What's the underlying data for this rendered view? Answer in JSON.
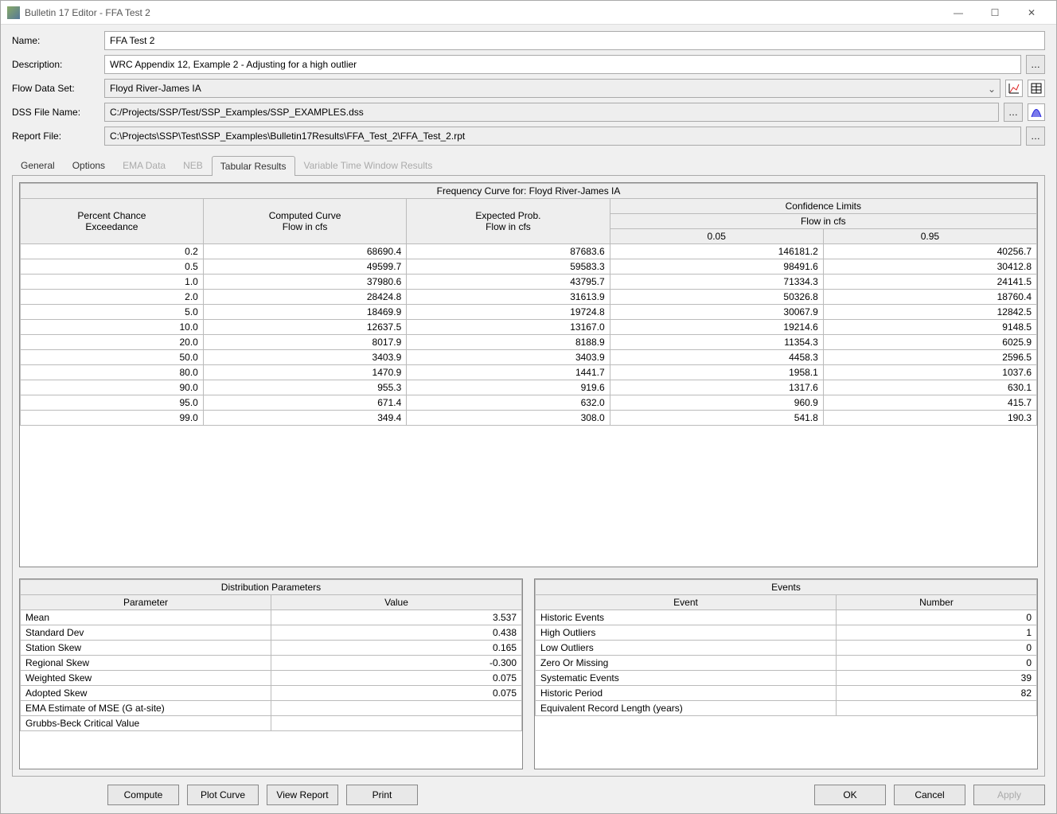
{
  "window_title": "Bulletin 17 Editor - FFA Test 2",
  "labels": {
    "name": "Name:",
    "description": "Description:",
    "flow_data_set": "Flow Data Set:",
    "dss_file_name": "DSS File Name:",
    "report_file": "Report File:"
  },
  "fields": {
    "name": "FFA Test 2",
    "description": "WRC Appendix 12, Example 2 - Adjusting for a high outlier",
    "flow_data_set": "Floyd River-James IA",
    "dss_file_name": "C:/Projects/SSP/Test/SSP_Examples/SSP_EXAMPLES.dss",
    "report_file": "C:\\Projects\\SSP\\Test\\SSP_Examples\\Bulletin17Results\\FFA_Test_2\\FFA_Test_2.rpt"
  },
  "tabs": {
    "general": "General",
    "options": "Options",
    "ema_data": "EMA Data",
    "neb": "NEB",
    "tabular_results": "Tabular Results",
    "variable_time": "Variable Time Window Results"
  },
  "freq_table": {
    "title": "Frequency Curve for: Floyd River-James IA",
    "headers": {
      "pce": "Percent Chance\nExceedance",
      "computed": "Computed Curve\nFlow in cfs",
      "expected": "Expected Prob.\nFlow in cfs",
      "conf_limits": "Confidence Limits",
      "flow_in_cfs": "Flow in cfs",
      "cl_05": "0.05",
      "cl_95": "0.95"
    },
    "rows": [
      {
        "pce": "0.2",
        "computed": "68690.4",
        "expected": "87683.6",
        "cl05": "146181.2",
        "cl95": "40256.7"
      },
      {
        "pce": "0.5",
        "computed": "49599.7",
        "expected": "59583.3",
        "cl05": "98491.6",
        "cl95": "30412.8"
      },
      {
        "pce": "1.0",
        "computed": "37980.6",
        "expected": "43795.7",
        "cl05": "71334.3",
        "cl95": "24141.5"
      },
      {
        "pce": "2.0",
        "computed": "28424.8",
        "expected": "31613.9",
        "cl05": "50326.8",
        "cl95": "18760.4"
      },
      {
        "pce": "5.0",
        "computed": "18469.9",
        "expected": "19724.8",
        "cl05": "30067.9",
        "cl95": "12842.5"
      },
      {
        "pce": "10.0",
        "computed": "12637.5",
        "expected": "13167.0",
        "cl05": "19214.6",
        "cl95": "9148.5"
      },
      {
        "pce": "20.0",
        "computed": "8017.9",
        "expected": "8188.9",
        "cl05": "11354.3",
        "cl95": "6025.9"
      },
      {
        "pce": "50.0",
        "computed": "3403.9",
        "expected": "3403.9",
        "cl05": "4458.3",
        "cl95": "2596.5"
      },
      {
        "pce": "80.0",
        "computed": "1470.9",
        "expected": "1441.7",
        "cl05": "1958.1",
        "cl95": "1037.6"
      },
      {
        "pce": "90.0",
        "computed": "955.3",
        "expected": "919.6",
        "cl05": "1317.6",
        "cl95": "630.1"
      },
      {
        "pce": "95.0",
        "computed": "671.4",
        "expected": "632.0",
        "cl05": "960.9",
        "cl95": "415.7"
      },
      {
        "pce": "99.0",
        "computed": "349.4",
        "expected": "308.0",
        "cl05": "541.8",
        "cl95": "190.3"
      }
    ]
  },
  "dist_params": {
    "title": "Distribution Parameters",
    "headers": {
      "param": "Parameter",
      "value": "Value"
    },
    "rows": [
      {
        "param": "Mean",
        "value": "3.537"
      },
      {
        "param": "Standard Dev",
        "value": "0.438"
      },
      {
        "param": "Station Skew",
        "value": "0.165"
      },
      {
        "param": "Regional Skew",
        "value": "-0.300"
      },
      {
        "param": "Weighted Skew",
        "value": "0.075"
      },
      {
        "param": "Adopted Skew",
        "value": "0.075"
      },
      {
        "param": "EMA Estimate of MSE (G at-site)",
        "value": ""
      },
      {
        "param": "Grubbs-Beck Critical Value",
        "value": ""
      }
    ]
  },
  "events": {
    "title": "Events",
    "headers": {
      "event": "Event",
      "number": "Number"
    },
    "rows": [
      {
        "event": "Historic Events",
        "number": "0"
      },
      {
        "event": "High Outliers",
        "number": "1"
      },
      {
        "event": "Low Outliers",
        "number": "0"
      },
      {
        "event": "Zero Or Missing",
        "number": "0"
      },
      {
        "event": "Systematic Events",
        "number": "39"
      },
      {
        "event": "Historic Period",
        "number": "82"
      },
      {
        "event": "Equivalent Record Length (years)",
        "number": ""
      }
    ]
  },
  "buttons": {
    "compute": "Compute",
    "plot_curve": "Plot Curve",
    "view_report": "View Report",
    "print": "Print",
    "ok": "OK",
    "cancel": "Cancel",
    "apply": "Apply"
  }
}
